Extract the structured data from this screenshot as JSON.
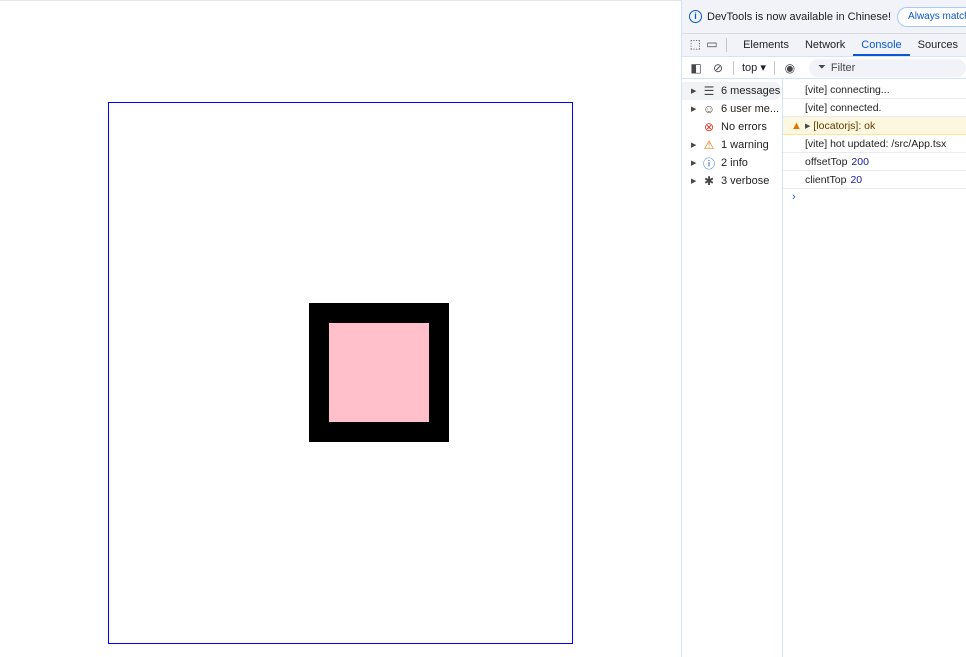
{
  "page": {
    "colors": {
      "outer_border": "#0000ff",
      "box_border": "#000000",
      "box_fill": "#ffc0cb"
    }
  },
  "devtools": {
    "infobar": {
      "message": "DevTools is now available in Chinese!",
      "button": "Always match Ch"
    },
    "tabs": [
      {
        "label": "Elements",
        "active": false
      },
      {
        "label": "Network",
        "active": false
      },
      {
        "label": "Console",
        "active": true
      },
      {
        "label": "Sources",
        "active": false
      }
    ],
    "toolbar": {
      "context": "top ▾",
      "filter_placeholder": "Filter"
    },
    "sidebar": [
      {
        "label": "6 messages",
        "icon": "list-icon",
        "glyph": "☰",
        "expandable": true
      },
      {
        "label": "6 user me...",
        "icon": "user-icon",
        "glyph": "☺",
        "expandable": true
      },
      {
        "label": "No errors",
        "icon": "error-icon",
        "glyph": "⊗",
        "expandable": false
      },
      {
        "label": "1 warning",
        "icon": "warning-icon",
        "glyph": "⚠",
        "expandable": true
      },
      {
        "label": "2 info",
        "icon": "info-icon",
        "glyph": "ⓘ",
        "expandable": true
      },
      {
        "label": "3 verbose",
        "icon": "bug-icon",
        "glyph": "✱",
        "expandable": true
      }
    ],
    "console": [
      {
        "text": "[vite] connecting...",
        "value": ""
      },
      {
        "text": "[vite] connected.",
        "value": ""
      },
      {
        "text": "[locatorjs]: ok",
        "value": "",
        "level": "warning"
      },
      {
        "text": "[vite] hot updated: /src/App.tsx",
        "value": ""
      },
      {
        "text": "offsetTop",
        "value": "200"
      },
      {
        "text": "clientTop",
        "value": "20"
      }
    ],
    "prompt": "›"
  }
}
